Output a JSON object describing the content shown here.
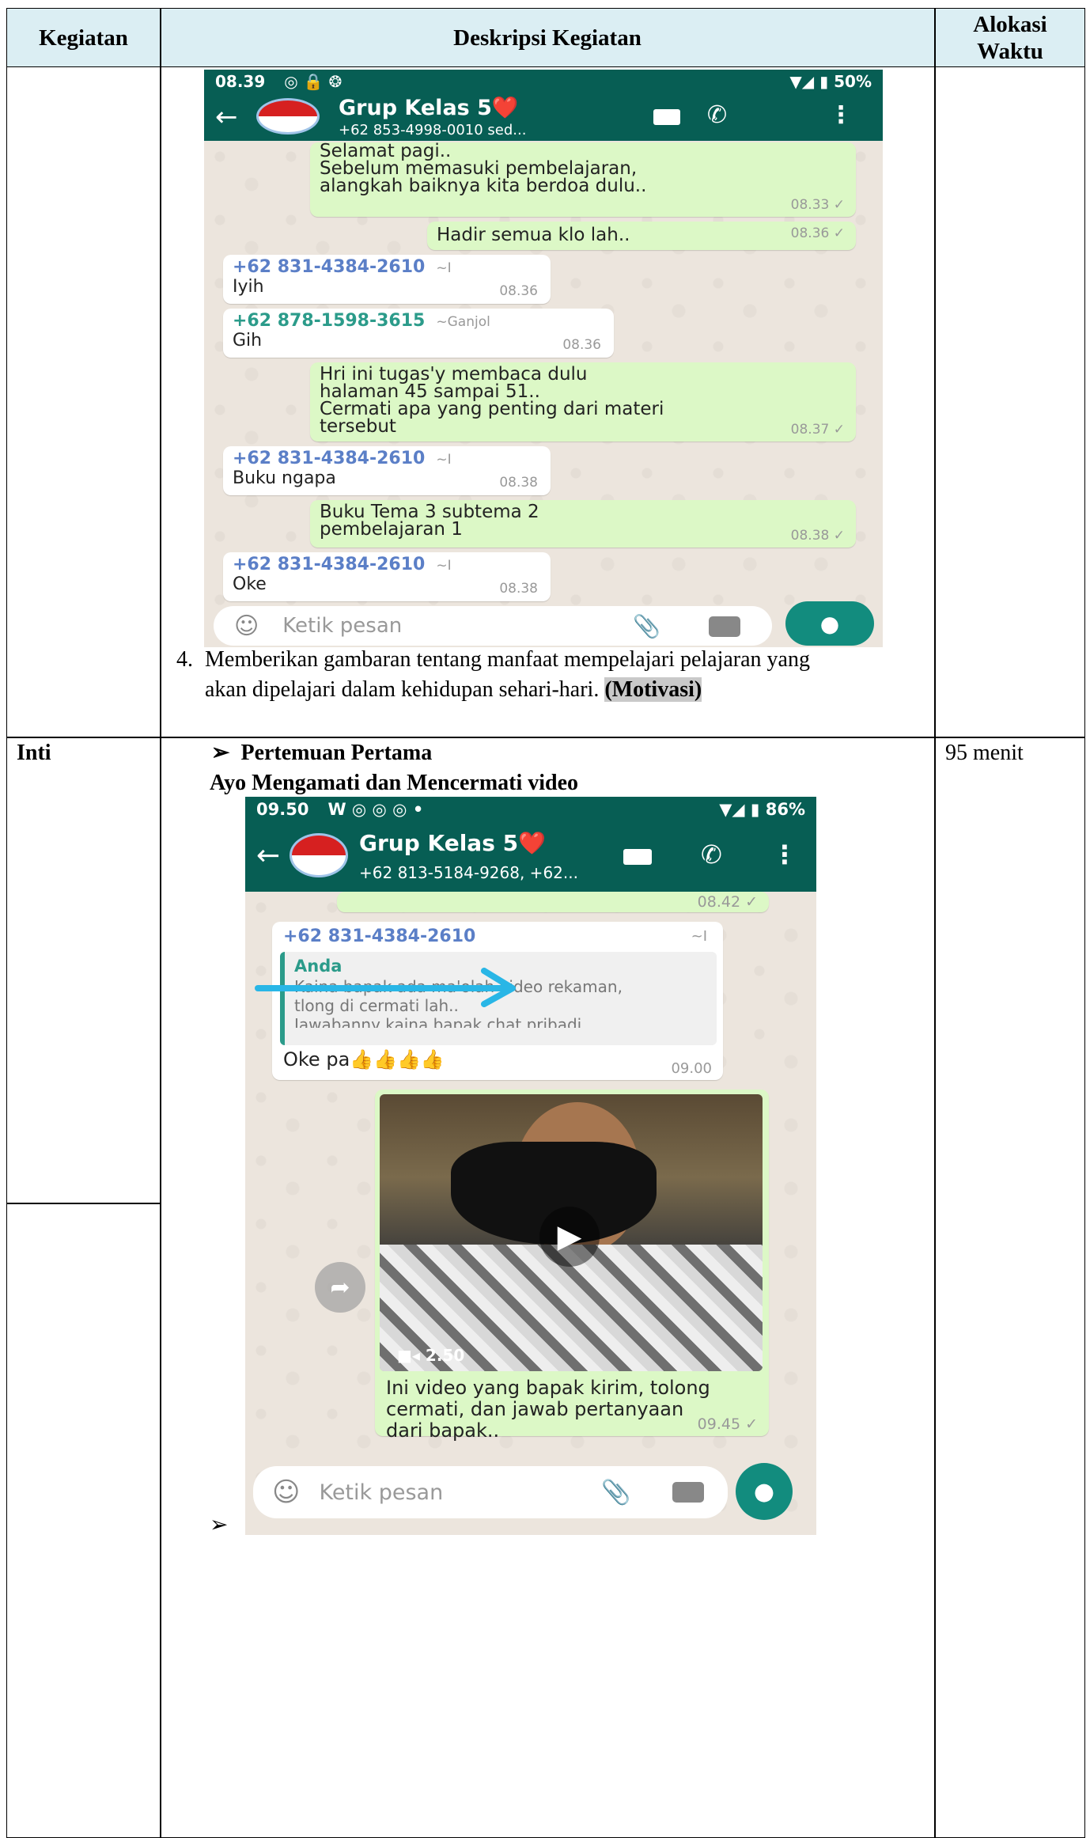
{
  "table": {
    "headers": [
      "Kegiatan",
      "Deskripsi Kegiatan",
      "Alokasi\nWaktu"
    ],
    "rows": [
      {
        "kegiatan": "",
        "item4_number": "4.",
        "item4_text_line1": "Memberikan gambaran tentang manfaat mempelajari pelajaran yang",
        "item4_text_line2": "akan dipelajari dalam kehidupan sehari-hari.",
        "item4_tag": "(Motivasi)",
        "waktu": ""
      },
      {
        "kegiatan": "Inti",
        "bullet": "➢",
        "meeting_title": "Pertemuan Pertama",
        "subheading": "Ayo Mengamati dan Mencermati video",
        "trailing_bullet": "➢",
        "waktu": "95 menit"
      }
    ]
  },
  "phone1": {
    "status_time": "08.39",
    "status_battery": "50%",
    "group_name": "Grup Kelas 5❤️",
    "group_subtitle": "+62 853-4998-0010 sed...",
    "messages": [
      {
        "dir": "out",
        "lines": [
          "Selamat pagi..",
          "Sebelum memasuki pembelajaran,",
          "alangkah baiknya kita berdoa dulu.."
        ],
        "time": "08.33 ✓"
      },
      {
        "dir": "out",
        "lines": [
          "Hadir semua klo lah.."
        ],
        "time": "08.36 ✓"
      },
      {
        "dir": "in",
        "sender": "+62 831-4384-2610",
        "alias": "~I",
        "lines": [
          "Iyih"
        ],
        "time": "08.36"
      },
      {
        "dir": "in",
        "sender": "+62 878-1598-3615",
        "alias": "~Ganjol",
        "lines": [
          "Gih"
        ],
        "time": "08.36"
      },
      {
        "dir": "out",
        "lines": [
          "Hri ini tugas'y membaca dulu",
          "halaman 45 sampai 51..",
          "Cermati apa yang penting dari materi",
          "tersebut"
        ],
        "time": "08.37 ✓"
      },
      {
        "dir": "in",
        "sender": "+62 831-4384-2610",
        "alias": "~I",
        "lines": [
          "Buku ngapa"
        ],
        "time": "08.38"
      },
      {
        "dir": "out",
        "lines": [
          "Buku Tema 3 subtema 2",
          "pembelajaran 1"
        ],
        "time": "08.38 ✓"
      },
      {
        "dir": "in",
        "sender": "+62 831-4384-2610",
        "alias": "~I",
        "lines": [
          "Oke"
        ],
        "time": "08.38"
      }
    ],
    "input_placeholder": "Ketik pesan"
  },
  "phone2": {
    "status_time": "09.50",
    "status_battery": "86%",
    "group_name": "Grup Kelas 5❤️",
    "group_subtitle": "+62 813-5184-9268, +62...",
    "prev_time": "08.42 ✓",
    "reply": {
      "sender": "+62 831-4384-2610",
      "alias": "~I",
      "quoted_name": "Anda",
      "quoted_line1": "Kaina bapak ada ma'olah video rekaman,",
      "quoted_line2": "tlong di cermati lah..",
      "quoted_line3": "Jawabanny kaina bapak chat pribadi..",
      "text": "Oke pa👍👍👍👍",
      "time": "09.00"
    },
    "video": {
      "duration": "2.50",
      "caption_line1": "Ini video yang bapak kirim, tolong",
      "caption_line2": "cermati, dan jawab pertanyaan",
      "caption_line3": "dari bapak..",
      "time": "09.45 ✓"
    },
    "input_placeholder": "Ketik pesan"
  },
  "colors": {
    "header_bg": "#dbeef3",
    "whatsapp_green": "#075e54",
    "bubble_out": "#dcf8c6",
    "chat_bg": "#ece5dd",
    "arrow": "#29b6e6"
  }
}
